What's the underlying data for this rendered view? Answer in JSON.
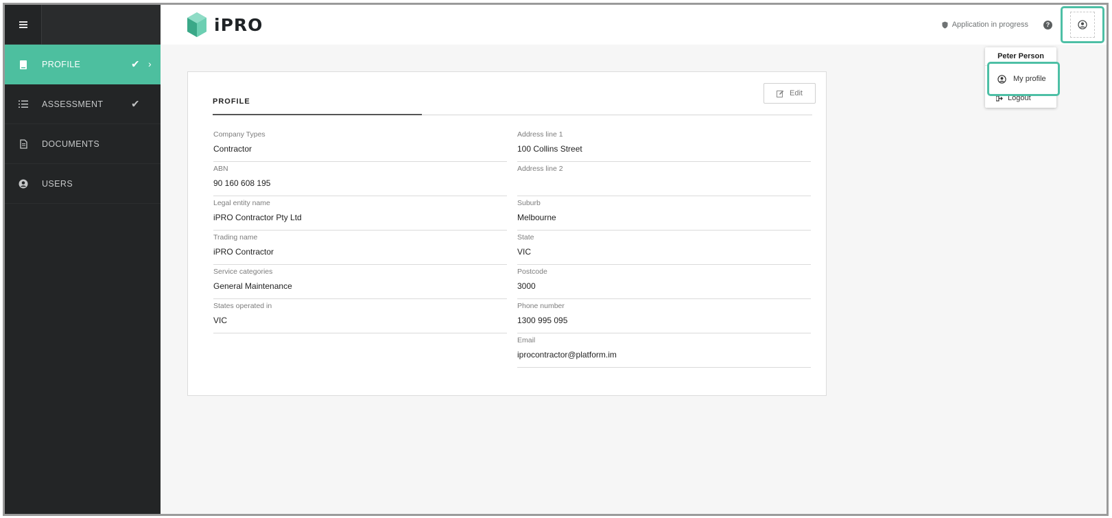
{
  "app": {
    "logo_text": "iPRO"
  },
  "header": {
    "status_text": "Application in progress",
    "help_glyph": "?"
  },
  "user_menu": {
    "user_name": "Peter Person",
    "items": [
      {
        "label": "My profile",
        "icon": "user-circle-icon"
      },
      {
        "label": "Logout",
        "icon": "logout-icon"
      }
    ]
  },
  "sidebar": {
    "items": [
      {
        "label": "PROFILE",
        "icon": "clipboard-icon",
        "active": true,
        "checked": true
      },
      {
        "label": "ASSESSMENT",
        "icon": "list-icon",
        "active": false,
        "checked": true
      },
      {
        "label": "DOCUMENTS",
        "icon": "document-icon",
        "active": false,
        "checked": false
      },
      {
        "label": "USERS",
        "icon": "user-circle-icon",
        "active": false,
        "checked": false
      }
    ]
  },
  "profile": {
    "title": "PROFILE",
    "edit_label": "Edit",
    "left_fields": [
      {
        "label": "Company Types",
        "value": "Contractor"
      },
      {
        "label": "ABN",
        "value": "90 160 608 195"
      },
      {
        "label": "Legal entity name",
        "value": "iPRO Contractor Pty Ltd"
      },
      {
        "label": "Trading name",
        "value": "iPRO Contractor"
      },
      {
        "label": "Service categories",
        "value": "General Maintenance"
      },
      {
        "label": "States operated in",
        "value": "VIC"
      }
    ],
    "right_fields": [
      {
        "label": "Address line 1",
        "value": "100 Collins Street"
      },
      {
        "label": "Address line 2",
        "value": ""
      },
      {
        "label": "Suburb",
        "value": "Melbourne"
      },
      {
        "label": "State",
        "value": "VIC"
      },
      {
        "label": "Postcode",
        "value": "3000"
      },
      {
        "label": "Phone number",
        "value": "1300 995 095"
      },
      {
        "label": "Email",
        "value": "iprocontractor@platform.im"
      }
    ]
  },
  "colors": {
    "accent": "#4dbf9f",
    "sidebar_bg": "#232526",
    "highlight": "#4dbfa5"
  }
}
